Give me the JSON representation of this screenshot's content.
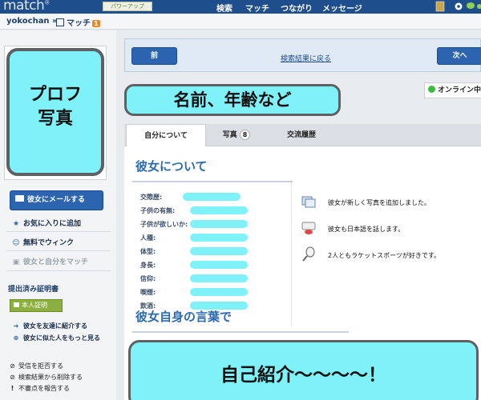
{
  "topbar": {
    "logo": "match",
    "powerup_label": "パワーアップ",
    "nav": [
      "検索",
      "マッチ",
      "つながり",
      "メッセージ"
    ]
  },
  "subbar": {
    "username": "yokochan »",
    "match_label": "マッチ",
    "match_count": "1"
  },
  "sidebar": {
    "photo_placeholder_line1": "プロフ",
    "photo_placeholder_line2": "写真",
    "mail_button": "彼女にメールする",
    "favorite": "お気に入りに追加",
    "wink": "無料でウィンク",
    "match_you": "彼女と自分をマッチ",
    "cert_title": "提出済み証明書",
    "cert_badge": "本人証明",
    "introduce": "彼女を友達に紹介する",
    "more_like": "彼女に似た人をもっと見る",
    "block": "受信を拒否する",
    "remove": "検索結果から削除する",
    "report": "不審点を報告する"
  },
  "pager": {
    "prev": "前",
    "back": "検索結果に戻る",
    "next": "次へ"
  },
  "profile": {
    "name_placeholder": "名前、年齢など",
    "online_status": "オンライン中"
  },
  "tabs": {
    "about": "自分について",
    "photos": "写真",
    "photos_count": "8",
    "history": "交流履歴"
  },
  "about": {
    "heading": "彼女について",
    "attributes": [
      "交際歴:",
      "子供の有無:",
      "子供が欲しいか:",
      "人種:",
      "体型:",
      "身長:",
      "信仰:",
      "喫煙:",
      "飲酒:"
    ],
    "facts": [
      "彼女が新しく写真を追加しました。",
      "彼女も日本語を話します。",
      "2人ともラケットスポーツが好きです。"
    ],
    "words_heading": "彼女自身の言葉で",
    "intro_placeholder": "自己紹介〜〜〜〜！"
  },
  "colors": {
    "nav_blue": "#1f4e8c",
    "button_blue": "#2d64b0",
    "heading_blue": "#2d6bb0",
    "highlight_cyan": "#7ff2f9",
    "online_green": "#3dbb3d"
  }
}
